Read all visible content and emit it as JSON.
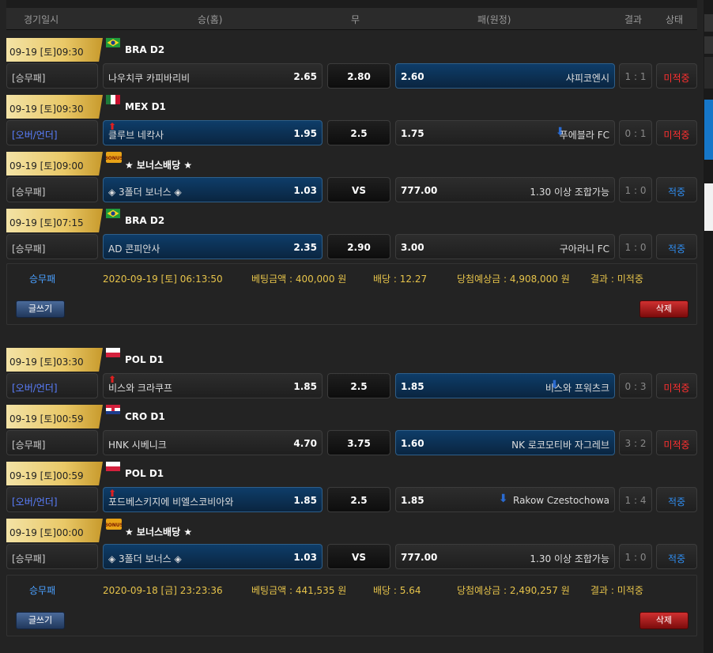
{
  "header": {
    "date": "경기일시",
    "home": "승(홈)",
    "draw": "무",
    "away": "패(원정)",
    "result": "결과",
    "status": "상태"
  },
  "slips": [
    {
      "matches": [
        {
          "date": "09-19 [토]09:30",
          "flag": "brazil",
          "league": "BRA D2",
          "type": "[승무패]",
          "home": "나우치쿠 카피바리비",
          "home_odd": "2.65",
          "draw": "2.80",
          "away_odd": "2.60",
          "away": "샤피코엔시",
          "result": "1 : 1",
          "status": "미적중",
          "sel": "away"
        },
        {
          "date": "09-19 [토]09:30",
          "flag": "mexico",
          "league": "MEX D1",
          "type": "[오버/언더]",
          "home": "클루브 네칵사",
          "home_odd": "1.95",
          "draw": "2.5",
          "away_odd": "1.75",
          "away": "푸에블라 FC",
          "result": "0 : 1",
          "status": "미적중",
          "sel": "home",
          "home_arrow": "⬆",
          "away_arrow": "⬇"
        },
        {
          "date": "09-19 [토]09:00",
          "flag": "bonus",
          "league": "★ 보너스배당 ★",
          "type": "[승무패]",
          "home": "◈ 3폴더 보너스 ◈",
          "home_odd": "1.03",
          "draw": "VS",
          "away_odd": "777.00",
          "away": "1.30 이상 조합가능",
          "result": "1 : 0",
          "status": "적중",
          "sel": "home"
        },
        {
          "date": "09-19 [토]07:15",
          "flag": "brazil",
          "league": "BRA D2",
          "type": "[승무패]",
          "home": "AD 콘피안사",
          "home_odd": "2.35",
          "draw": "2.90",
          "away_odd": "3.00",
          "away": "구아라니 FC",
          "result": "1 : 0",
          "status": "적중",
          "sel": "home"
        }
      ],
      "summary": {
        "label": "승무패",
        "time": "2020-09-19 [토] 06:13:50",
        "bet": "베팅금액 : 400,000 원",
        "odds": "배당 : 12.27",
        "win": "당첨예상금 : 4,908,000 원",
        "result": "결과 : 미적중"
      }
    },
    {
      "matches": [
        {
          "date": "09-19 [토]03:30",
          "flag": "poland",
          "league": "POL D1",
          "type": "[오버/언더]",
          "home": "비스와 크라쿠프",
          "home_odd": "1.85",
          "draw": "2.5",
          "away_odd": "1.85",
          "away": "비스와 프워츠크",
          "result": "0 : 3",
          "status": "미적중",
          "sel": "away",
          "home_arrow": "⬆",
          "away_arrow": "⬇"
        },
        {
          "date": "09-19 [토]00:59",
          "flag": "croatia",
          "league": "CRO D1",
          "type": "[승무패]",
          "home": "HNK 시베니크",
          "home_odd": "4.70",
          "draw": "3.75",
          "away_odd": "1.60",
          "away": "NK 로코모티바 자그레브",
          "result": "3 : 2",
          "status": "미적중",
          "sel": "away"
        },
        {
          "date": "09-19 [토]00:59",
          "flag": "poland",
          "league": "POL D1",
          "type": "[오버/언더]",
          "home": "포드베스키지에 비엘스코비아와",
          "home_odd": "1.85",
          "draw": "2.5",
          "away_odd": "1.85",
          "away": "Rakow Czestochowa",
          "result": "1 : 4",
          "status": "적중",
          "sel": "home",
          "home_arrow": "⬆",
          "away_arrow": "⬇"
        },
        {
          "date": "09-19 [토]00:00",
          "flag": "bonus",
          "league": "★ 보너스배당 ★",
          "type": "[승무패]",
          "home": "◈ 3폴더 보너스 ◈",
          "home_odd": "1.03",
          "draw": "VS",
          "away_odd": "777.00",
          "away": "1.30 이상 조합가능",
          "result": "1 : 0",
          "status": "적중",
          "sel": "home"
        }
      ],
      "summary": {
        "label": "승무패",
        "time": "2020-09-18 [금] 23:23:36",
        "bet": "베팅금액 : 441,535 원",
        "odds": "배당 : 5.64",
        "win": "당첨예상금 : 2,490,257 원",
        "result": "결과 : 미적중"
      }
    }
  ],
  "buttons": {
    "write": "글쓰기",
    "delete": "삭제"
  },
  "colors": {
    "pending": "#ff3030",
    "hit": "#2f8df0",
    "badge": "#e9c867",
    "selected": "#0e3d69"
  }
}
